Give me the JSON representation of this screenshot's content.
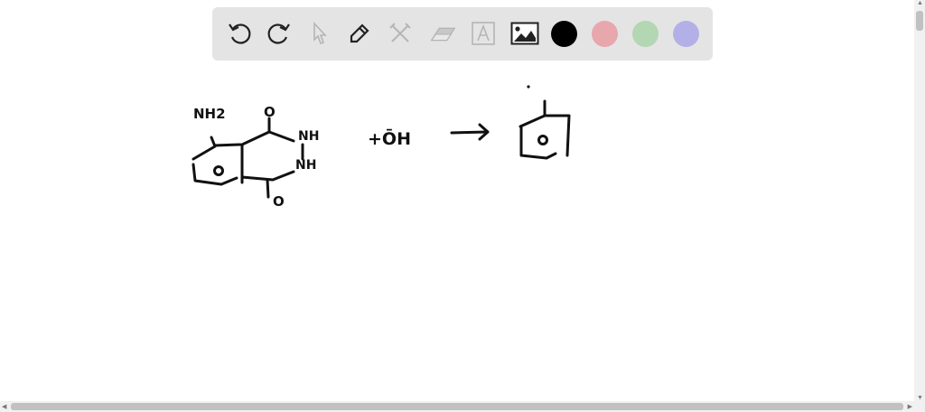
{
  "toolbar": {
    "tools": [
      "undo-icon",
      "redo-icon",
      "select-icon",
      "pen-icon",
      "tools-icon",
      "eraser-icon",
      "text-icon",
      "image-icon"
    ],
    "colors": [
      "#000000",
      "#e8a6ad",
      "#b3d6b3",
      "#b3b0e8"
    ]
  },
  "drawing": {
    "nh2": "NH2",
    "o_top": "O",
    "nh_top": "NH",
    "nh_bottom": "NH",
    "o_bottom": "O",
    "plus_oh": "+ŌH"
  }
}
